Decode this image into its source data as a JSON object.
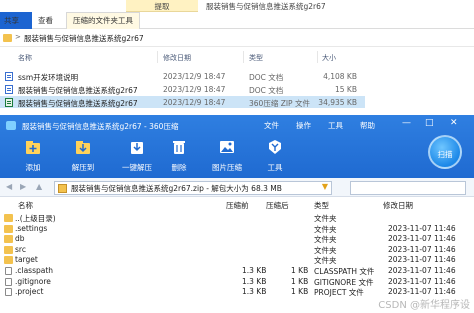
{
  "explorer": {
    "context_tab": "提取",
    "window_title": "服装销售与促销信息推送系统g2r67",
    "ribbon_tabs": {
      "file": "",
      "share": "共享",
      "view": "查看",
      "tools": "压缩的文件夹工具"
    },
    "address": {
      "separator": ">",
      "path": "服装销售与促销信息推送系统g2r67"
    },
    "columns": {
      "name": "名称",
      "modified": "修改日期",
      "type": "类型",
      "size": "大小"
    },
    "files": [
      {
        "name": "ssm开发环境说明",
        "modified": "2023/12/9 18:47",
        "type": "DOC 文档",
        "size": "4,108 KB",
        "kind": "doc"
      },
      {
        "name": "服装销售与促销信息推送系统g2r67",
        "modified": "2023/12/9 18:47",
        "type": "DOC 文档",
        "size": "15 KB",
        "kind": "doc"
      },
      {
        "name": "服装销售与促销信息推送系统g2r67",
        "modified": "2023/12/9 18:47",
        "type": "360压缩 ZIP 文件",
        "size": "34,935 KB",
        "kind": "zip"
      }
    ]
  },
  "zip": {
    "title": "服装销售与促销信息推送系统g2r67 - 360压缩",
    "menu": {
      "file": "文件",
      "operation": "操作",
      "tools": "工具",
      "help": "帮助"
    },
    "window_controls": {
      "minimize": "—",
      "maximize": "□",
      "close": "✕"
    },
    "toolbar": [
      {
        "label": "添加",
        "icon": "add-icon",
        "color": "#ffffff"
      },
      {
        "label": "解压到",
        "icon": "extract-to-icon",
        "color": "#ffffff"
      },
      {
        "label": "一键解压",
        "icon": "one-click-extract-icon",
        "color": "#ffffff"
      },
      {
        "label": "删除",
        "icon": "delete-icon",
        "color": "#ffffff"
      },
      {
        "label": "图片压缩",
        "icon": "image-compress-icon",
        "color": "#ffffff"
      },
      {
        "label": "工具",
        "icon": "tools-icon",
        "color": "#ffffff"
      }
    ],
    "scan_label": "扫描",
    "path": "服装销售与促销信息推送系统g2r67.zip - 解包大小为 68.3 MB",
    "columns": {
      "name": "名称",
      "compressed": "压缩前",
      "original": "压缩后",
      "type": "类型",
      "modified": "修改日期"
    },
    "rows": [
      {
        "name": "..(上级目录)",
        "compressed": "",
        "original": "",
        "type": "文件夹",
        "modified": "",
        "kind": "folder"
      },
      {
        "name": ".settings",
        "compressed": "",
        "original": "",
        "type": "文件夹",
        "modified": "2023-11-07 11:46",
        "kind": "folder"
      },
      {
        "name": "db",
        "compressed": "",
        "original": "",
        "type": "文件夹",
        "modified": "2023-11-07 11:46",
        "kind": "folder"
      },
      {
        "name": "src",
        "compressed": "",
        "original": "",
        "type": "文件夹",
        "modified": "2023-11-07 11:46",
        "kind": "folder"
      },
      {
        "name": "target",
        "compressed": "",
        "original": "",
        "type": "文件夹",
        "modified": "2023-11-07 11:46",
        "kind": "folder"
      },
      {
        "name": ".classpath",
        "compressed": "1.3 KB",
        "original": "1 KB",
        "type": "CLASSPATH 文件",
        "modified": "2023-11-07 11:46",
        "kind": "doc"
      },
      {
        "name": ".gitignore",
        "compressed": "1.3 KB",
        "original": "1 KB",
        "type": "GITIGNORE 文件",
        "modified": "2023-11-07 11:46",
        "kind": "doc"
      },
      {
        "name": ".project",
        "compressed": "1.3 KB",
        "original": "1 KB",
        "type": "PROJECT 文件",
        "modified": "2023-11-07 11:46",
        "kind": "doc"
      }
    ],
    "watermark": "CSDN @新华程序设"
  }
}
